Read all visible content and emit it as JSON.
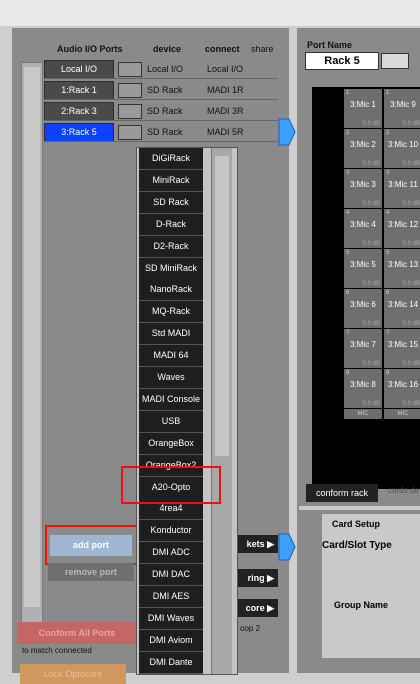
{
  "columns": {
    "ports": "Audio I/O Ports",
    "device": "device",
    "connect": "connect",
    "share": "share"
  },
  "rows": [
    {
      "port": "Local I/O",
      "device": "Local I/O",
      "connect": "Local I/O"
    },
    {
      "port": "1:Rack 1",
      "device": "SD Rack",
      "connect": "MADI 1R"
    },
    {
      "port": "2:Rack 3",
      "device": "SD Rack",
      "connect": "MADI 3R"
    },
    {
      "port": "3:Rack 5",
      "device": "SD Rack",
      "connect": "MADI 5R"
    }
  ],
  "dropdown": [
    "DiGiRack",
    "MiniRack",
    "SD Rack",
    "D-Rack",
    "D2-Rack",
    "SD MiniRack",
    "NanoRack",
    "MQ-Rack",
    "Std MADI",
    "MADI 64",
    "Waves",
    "MADI Console",
    "USB",
    "OrangeBox",
    "OrangeBox2",
    "A20-Opto",
    "4rea4",
    "Konductor",
    "DMI ADC",
    "DMI DAC",
    "DMI AES",
    "DMI Waves",
    "DMI Aviom",
    "DMI Dante"
  ],
  "buttons": {
    "add_port": "add port",
    "remove_port": "remove port",
    "conform_all": "Conform All Ports",
    "conform_note": "to match connected",
    "lock_opto": "Lock Optocore",
    "sockets": "kets",
    "routing": "ring",
    "optocore": "core",
    "loop": "oop 2"
  },
  "port_name": {
    "label": "Port Name",
    "value": "Rack 5"
  },
  "channels": [
    {
      "num": "1",
      "left": "3:Mic 1",
      "right": "3:Mic 9",
      "db": "0.0 dB"
    },
    {
      "num": "2",
      "left": "3:Mic 2",
      "right": "3:Mic 10",
      "db": "0.0 dB"
    },
    {
      "num": "3",
      "left": "3:Mic 3",
      "right": "3:Mic 11",
      "db": "0.0 dB"
    },
    {
      "num": "4",
      "left": "3:Mic 4",
      "right": "3:Mic 12",
      "db": "0.0 dB"
    },
    {
      "num": "5",
      "left": "3:Mic 5",
      "right": "3:Mic 13",
      "db": "0.0 dB"
    },
    {
      "num": "6",
      "left": "3:Mic 6",
      "right": "3:Mic 14",
      "db": "0.0 dB"
    },
    {
      "num": "7",
      "left": "3:Mic 7",
      "right": "3:Mic 15",
      "db": "0.0 dB"
    },
    {
      "num": "8",
      "left": "3:Mic 8",
      "right": "3:Mic 16",
      "db": "0.0 dB"
    }
  ],
  "mic_labels": [
    "MIC",
    "MIC"
  ],
  "conform_rack": "conform rack",
  "cards_dev": "cards de",
  "card_setup": {
    "title": "Card Setup",
    "slot_type": "Card/Slot Type",
    "group_name": "Group Name"
  },
  "colors": {
    "selected": "#1040ff",
    "highlight": "#ee1111",
    "arrow": "#3aa0ff"
  }
}
